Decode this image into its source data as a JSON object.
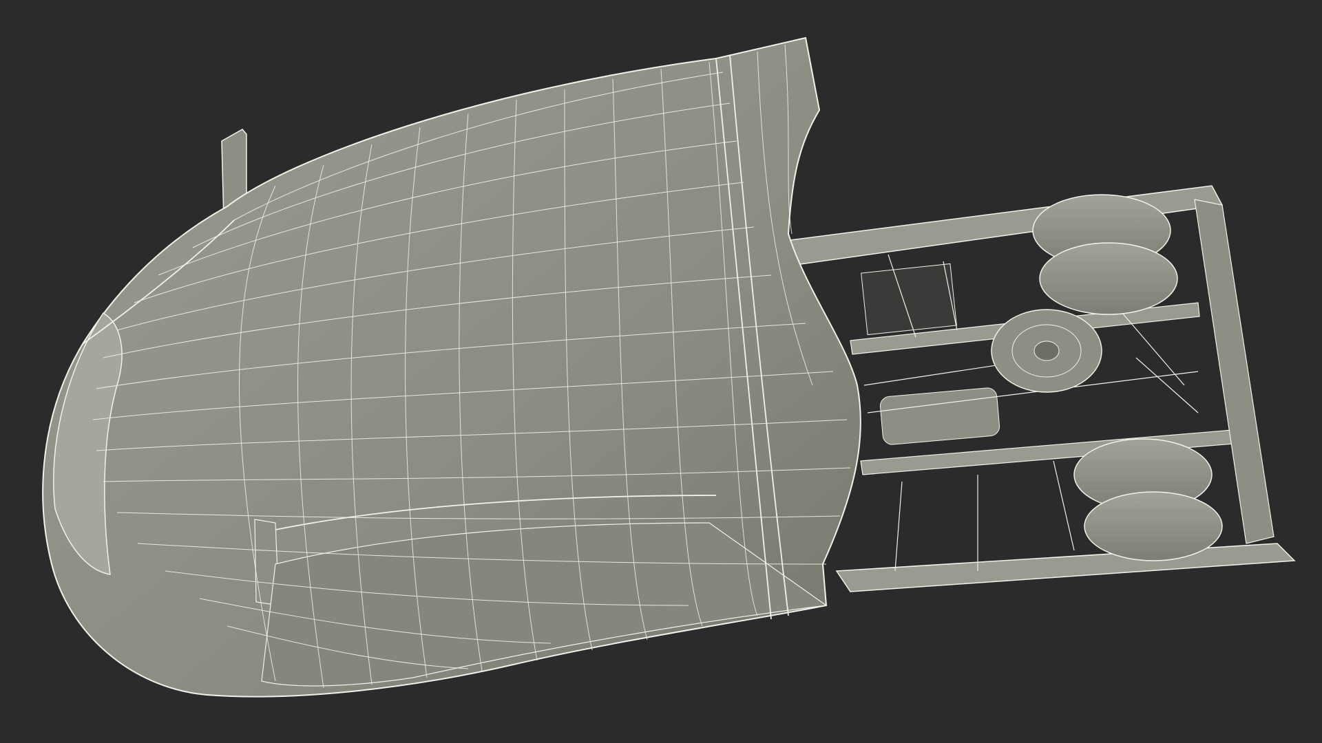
{
  "scene": {
    "background_color": "#2b2b2b",
    "shell_color": "#8e8e84",
    "shell_shadow_color": "#6e6e66",
    "wire_color": "#f2f2ea",
    "frame_color": "#9a9a90",
    "dark_part_color": "#3a3a38",
    "subject": "wireframe-3d-model-truck-cab-underside"
  }
}
